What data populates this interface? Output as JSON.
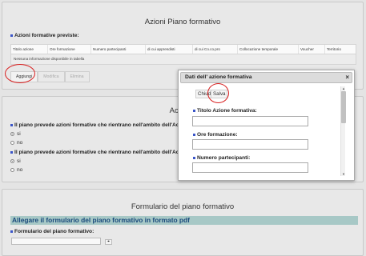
{
  "panel1": {
    "title": "Azioni Piano formativo",
    "section_label": "Azioni formative previste:",
    "columns": [
      "Titolo azione",
      "Ore formazione",
      "Numero partecipanti",
      "di cui apprendisti",
      "di cui Co.co.pro",
      "Collocazione temporale",
      "Voucher",
      "Territorio"
    ],
    "empty_text": "Nessuna informazione disponibile in tabella",
    "buttons": {
      "add": "Aggiungi",
      "edit": "Modifica",
      "delete": "Elimina"
    }
  },
  "panel2": {
    "title": "Accordi S",
    "question1": "Il piano prevede azioni formative che rientrano nell'ambito dell'Acco",
    "question2": "Il piano prevede azioni formative che rientrano nell'ambito dell'Acco",
    "yes": "si",
    "no": "no",
    "q1_selected": "si",
    "q2_selected": "si"
  },
  "panel3": {
    "title": "Formulario del piano formativo",
    "upload_heading": "Allegare il formulario del piano formativo in formato pdf",
    "field_label": "Formulario del piano formativo:",
    "browse_icon": "attach-icon"
  },
  "dialog": {
    "title": "Dati dell' azione formativa",
    "close_icon": "close-icon",
    "close_label": "Chiudi",
    "save_label": "Salva",
    "fields": [
      "Titolo Azione formativa:",
      "Ore formazione:",
      "Numero partecipanti:"
    ]
  },
  "colors": {
    "bullet": "#3a55c8",
    "highlight": "#d81f1f",
    "pdf_bar": "#a7c8c6",
    "pdf_text": "#1a4a7c"
  }
}
